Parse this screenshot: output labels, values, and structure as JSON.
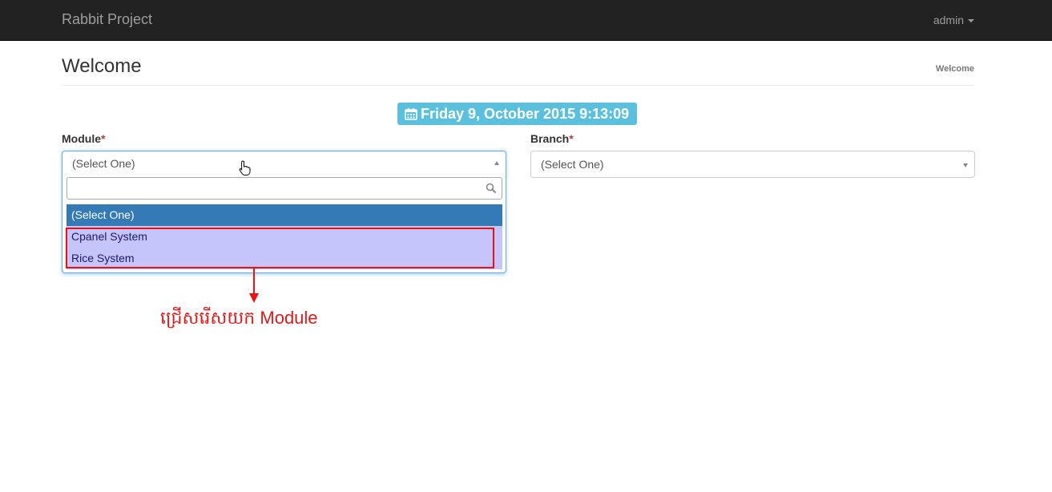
{
  "navbar": {
    "brand": "Rabbit Project",
    "user": "admin"
  },
  "header": {
    "title": "Welcome",
    "breadcrumb": "Welcome"
  },
  "datetime": "Friday 9, October 2015 9:13:09",
  "module": {
    "label": "Module",
    "required_mark": "*",
    "selected": "(Select One)",
    "search_value": "",
    "options": [
      "(Select One)",
      "Cpanel System",
      "Rice System"
    ]
  },
  "branch": {
    "label": "Branch",
    "required_mark": "*",
    "selected": "(Select One)"
  },
  "annotation": {
    "text": "ជ្រើសរើសយក Module",
    "color": "#e01818"
  },
  "colors": {
    "navbar": "#222222",
    "date_badge": "#5bc0de",
    "option_selected": "#337ab7",
    "option_highlight": "#c5c5fb",
    "annotation_border": "#ee1111"
  },
  "icons": {
    "date": "calendar-icon",
    "search": "search-icon",
    "cursor": "hand-pointer-icon"
  }
}
